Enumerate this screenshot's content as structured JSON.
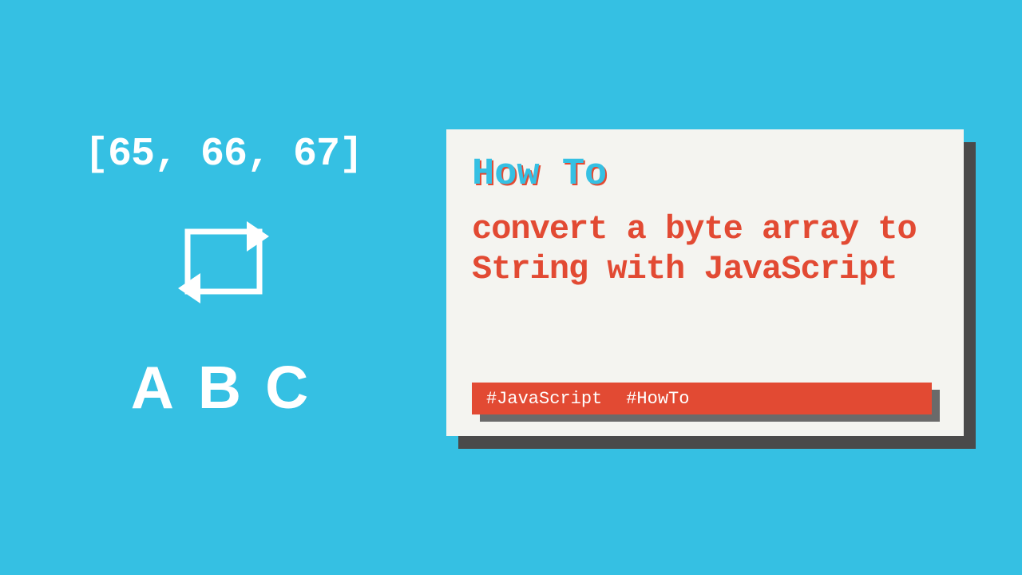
{
  "left": {
    "byte_array": "[65, 66, 67]",
    "result_string": "ABC"
  },
  "card": {
    "overline": "How To",
    "headline": "convert a byte array to String with JavaScript"
  },
  "tags": [
    "#JavaScript",
    "#HowTo"
  ]
}
